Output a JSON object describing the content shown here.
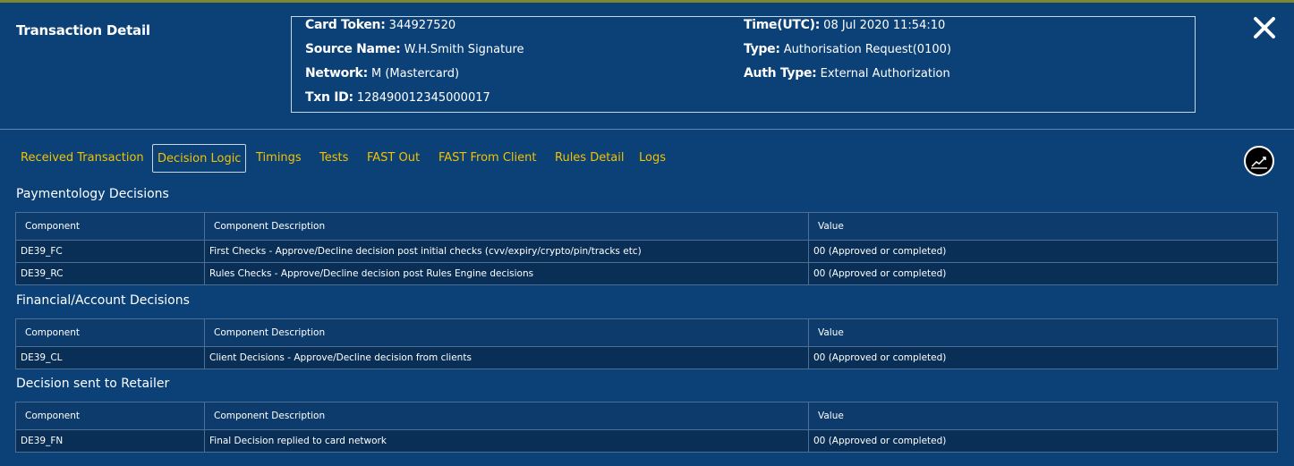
{
  "title": "Transaction Detail",
  "info": {
    "card_token": {
      "label": "Card Token:",
      "value": "344927520"
    },
    "source_name": {
      "label": "Source Name:",
      "value": "W.H.Smith Signature"
    },
    "network": {
      "label": "Network:",
      "value": "M (Mastercard)"
    },
    "txn_id": {
      "label": "Txn ID:",
      "value": "128490012345000017"
    },
    "time": {
      "label": "Time(UTC):",
      "value": "08 Jul 2020 11:54:10"
    },
    "type": {
      "label": "Type:",
      "value": "Authorisation Request(0100)"
    },
    "auth_type": {
      "label": "Auth Type:",
      "value": "External Authorization"
    }
  },
  "tabs": [
    {
      "label": "Received Transaction"
    },
    {
      "label": "Decision Logic"
    },
    {
      "label": "Timings"
    },
    {
      "label": "Tests"
    },
    {
      "label": "FAST Out"
    },
    {
      "label": "FAST From Client"
    },
    {
      "label": "Rules Detail"
    },
    {
      "label": "Logs"
    }
  ],
  "active_tab": "Decision Logic",
  "columns": [
    "Component",
    "Component Description",
    "Value"
  ],
  "sections": [
    {
      "title": "Paymentology Decisions",
      "rows": [
        [
          "DE39_FC",
          "First Checks - Approve/Decline decision post initial checks (cvv/expiry/crypto/pin/tracks etc)",
          "00 (Approved or completed)"
        ],
        [
          "DE39_RC",
          "Rules Checks - Approve/Decline decision post Rules Engine decisions",
          "00 (Approved or completed)"
        ]
      ]
    },
    {
      "title": "Financial/Account Decisions",
      "rows": [
        [
          "DE39_CL",
          "Client Decisions - Approve/Decline decision from clients",
          "00 (Approved or completed)"
        ]
      ]
    },
    {
      "title": "Decision sent to Retailer",
      "rows": [
        [
          "DE39_FN",
          "Final Decision replied to card network",
          "00 (Approved or completed)"
        ]
      ]
    }
  ],
  "icons": {
    "close": "close-icon",
    "chart": "chart-icon"
  },
  "colors": {
    "background": "#0b4177",
    "tab_text": "#f2c200",
    "row_bg": "#0a2f57"
  }
}
